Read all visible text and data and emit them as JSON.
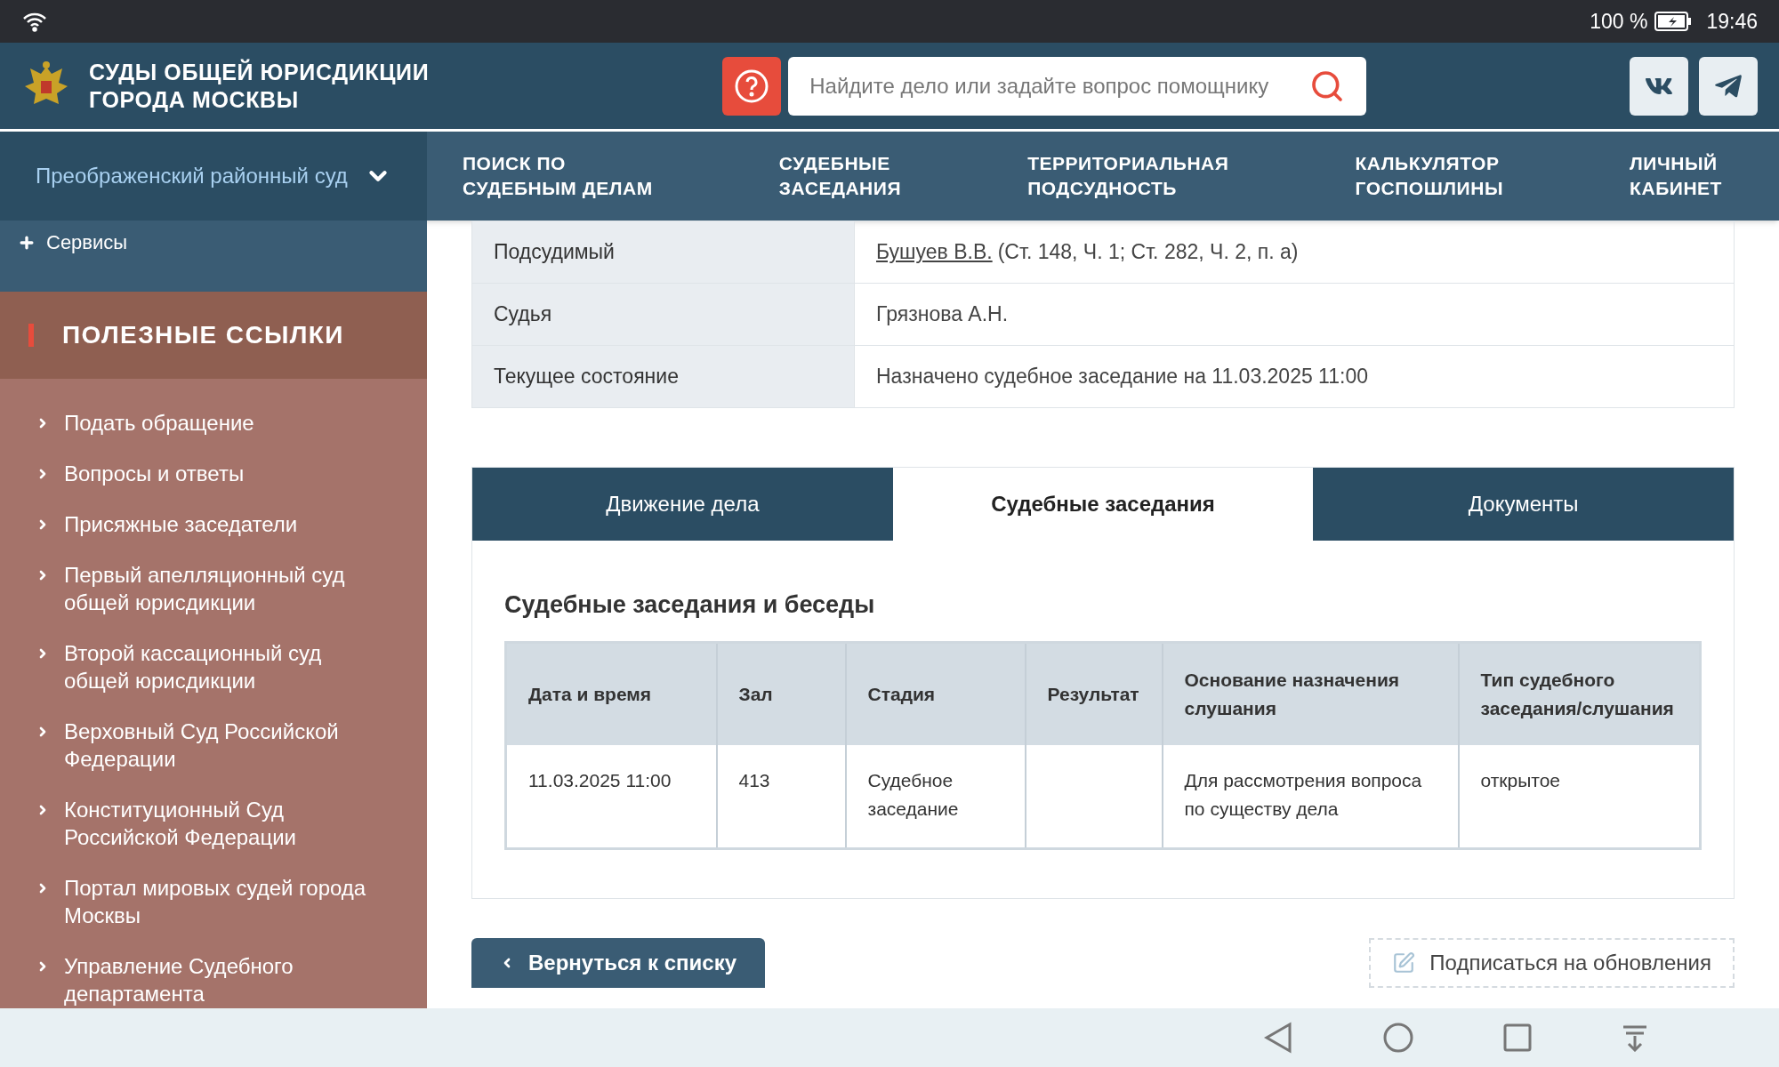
{
  "status_bar": {
    "battery": "100 %",
    "time": "19:46"
  },
  "header": {
    "title": "СУДЫ ОБЩЕЙ ЮРИСДИКЦИИ\nГОРОДА МОСКВЫ",
    "search": {
      "placeholder": "Найдите дело или задайте вопрос помощнику"
    }
  },
  "court_selector": {
    "label": "Преображенский районный суд"
  },
  "nav": [
    {
      "label": "ПОИСК ПО\nСУДЕБНЫМ ДЕЛАМ"
    },
    {
      "label": "СУДЕБНЫЕ\nЗАСЕДАНИЯ"
    },
    {
      "label": "ТЕРРИТОРИАЛЬНАЯ\nПОДСУДНОСТЬ"
    },
    {
      "label": "КАЛЬКУЛЯТОР\nГОСПОШЛИНЫ"
    },
    {
      "label": "ЛИЧНЫЙ\nКАБИНЕТ"
    }
  ],
  "sidebar": {
    "services": {
      "label": "Сервисы",
      "expanded": false
    },
    "links_title": "ПОЛЕЗНЫЕ ССЫЛКИ",
    "links": [
      "Подать обращение",
      "Вопросы и ответы",
      "Присяжные заседатели",
      "Первый апелляционный суд общей юрисдикции",
      "Второй кассационный суд общей юрисдикции",
      "Верховный Суд Российской Федерации",
      "Конституционный Суд Российской Федерации",
      "Портал мировых судей города Москвы",
      "Управление Судебного департамента"
    ]
  },
  "case_info": [
    {
      "label": "Подсудимый",
      "link": "Бушуев В.В.",
      "value": "(Ст. 148, Ч. 1; Ст. 282, Ч. 2, п. а)"
    },
    {
      "label": "Судья",
      "value": "Грязнова А.Н."
    },
    {
      "label": "Текущее состояние",
      "value": "Назначено судебное заседание на 11.03.2025 11:00"
    }
  ],
  "tabs": [
    {
      "label": "Движение дела",
      "selected": false
    },
    {
      "label": "Судебные заседания",
      "selected": true
    },
    {
      "label": "Документы",
      "selected": false
    }
  ],
  "sessions": {
    "title": "Судебные заседания и беседы",
    "columns": [
      "Дата и время",
      "Зал",
      "Стадия",
      "Результат",
      "Основание назначения слушания",
      "Тип судебного заседания/слушания"
    ],
    "rows": [
      [
        "11.03.2025 11:00",
        "413",
        "Судебное заседание",
        "",
        "Для рассмотрения вопроса по существу дела",
        "открытое"
      ]
    ]
  },
  "actions": {
    "back": "Вернуться к списку",
    "subscribe": "Подписаться на обновления"
  }
}
